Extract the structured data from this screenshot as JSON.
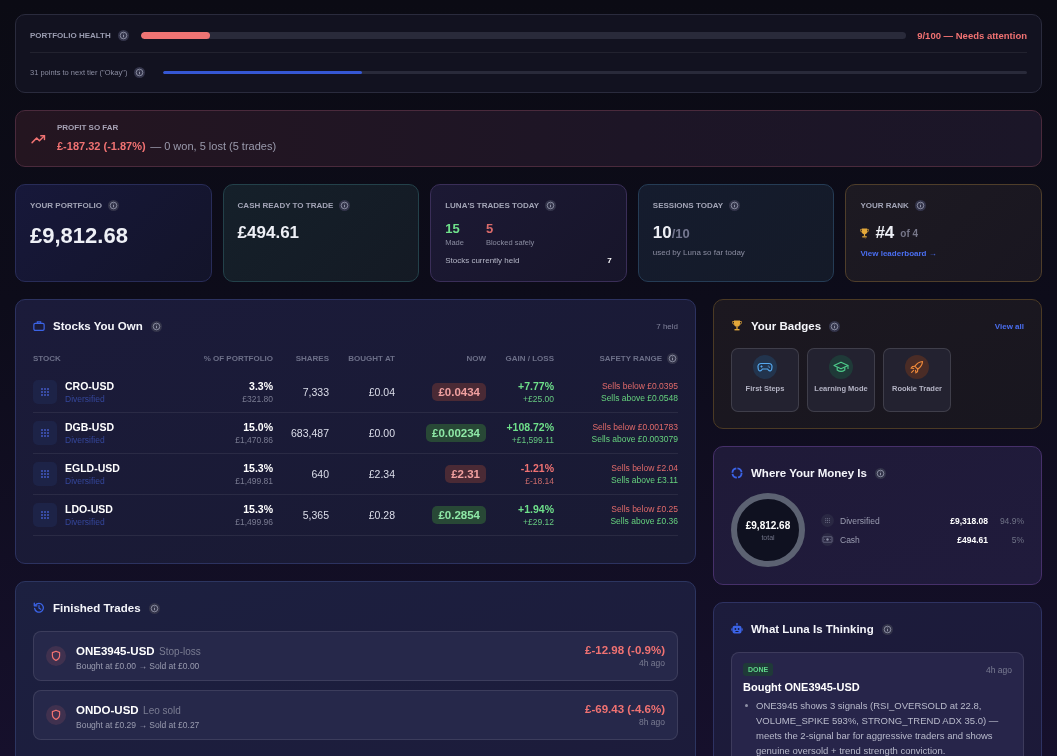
{
  "health": {
    "label": "PORTFOLIO HEALTH",
    "level": 0.09,
    "status": "9/100 — Needs attention",
    "next_tier": {
      "label": "31 points to next tier (\"Okay\")",
      "level": 0.23
    }
  },
  "profit": {
    "label": "PROFIT SO FAR",
    "amount": "£-187.32 (-1.87%)",
    "summary": "— 0 won, 5 lost (5 trades)",
    "loss": true
  },
  "stat_cards": [
    {
      "kind": "portfolio",
      "label": "YOUR PORTFOLIO",
      "value": "£9,812.68"
    },
    {
      "kind": "cash",
      "label": "CASH READY TO TRADE",
      "value": "£494.61"
    },
    {
      "kind": "trades",
      "label": "LUNA'S TRADES TODAY",
      "made": "15",
      "made_label": "Made",
      "blocked": "5",
      "blocked_label": "Blocked safely",
      "held_label": "Stocks currently held",
      "held": "7"
    },
    {
      "kind": "sessions",
      "label": "SESSIONS TODAY",
      "used": "10",
      "limit": "/10",
      "note": "used by Luna so far today"
    },
    {
      "kind": "rank",
      "label": "YOUR RANK",
      "rank": "#4",
      "out_of": "of 4",
      "link": "View leaderboard →"
    }
  ],
  "holdings": {
    "title": "Stocks You Own",
    "count": "7 held",
    "columns": [
      "STOCK",
      "% OF PORTFOLIO",
      "SHARES",
      "BOUGHT AT",
      "NOW",
      "GAIN / LOSS",
      "SAFETY RANGE"
    ],
    "rows": [
      {
        "ticker": "CRO-USD",
        "category": "Diversified",
        "share": "3.3%",
        "value": "£321.80",
        "shares": "7,333",
        "bought_at": "£0.04",
        "now": "£0.0434",
        "price_up": false,
        "gain_percent": "+7.77%",
        "gain_amount": "+£25.00",
        "gain_up": true,
        "sells_below": "Sells below £0.0395",
        "sells_above": "Sells above £0.0548"
      },
      {
        "ticker": "DGB-USD",
        "category": "Diversified",
        "share": "15.0%",
        "value": "£1,470.86",
        "shares": "683,487",
        "bought_at": "£0.00",
        "now": "£0.00234",
        "price_up": true,
        "gain_percent": "+108.72%",
        "gain_amount": "+£1,599.11",
        "gain_up": true,
        "sells_below": "Sells below £0.001783",
        "sells_above": "Sells above £0.003079"
      },
      {
        "ticker": "EGLD-USD",
        "category": "Diversified",
        "share": "15.3%",
        "value": "£1,499.81",
        "shares": "640",
        "bought_at": "£2.34",
        "now": "£2.31",
        "price_up": false,
        "gain_percent": "-1.21%",
        "gain_amount": "£-18.14",
        "gain_up": false,
        "sells_below": "Sells below £2.04",
        "sells_above": "Sells above £3.11"
      },
      {
        "ticker": "LDO-USD",
        "category": "Diversified",
        "share": "15.3%",
        "value": "£1,499.96",
        "shares": "5,365",
        "bought_at": "£0.28",
        "now": "£0.2854",
        "price_up": true,
        "gain_percent": "+1.94%",
        "gain_amount": "+£29.12",
        "gain_up": true,
        "sells_below": "Sells below £0.25",
        "sells_above": "Sells above £0.36"
      }
    ]
  },
  "finished_trades": {
    "title": "Finished Trades",
    "items": [
      {
        "ticker": "ONE3945-USD",
        "reason": "Stop-loss",
        "detail": "Bought at £0.00 → Sold at £0.00",
        "result": "£-12.98 (-0.9%)",
        "time": "4h ago",
        "loss": true
      },
      {
        "ticker": "ONDO-USD",
        "reason": "Leo sold",
        "detail": "Bought at £0.29 → Sold at £0.27",
        "result": "£-69.43 (-4.6%)",
        "time": "8h ago",
        "loss": true
      }
    ]
  },
  "badges": {
    "title": "Your Badges",
    "link": "View all",
    "items": [
      {
        "label": "First Steps"
      },
      {
        "label": "Learning Mode"
      },
      {
        "label": "Rookie Trader"
      }
    ]
  },
  "allocation": {
    "title": "Where Your Money Is",
    "total": "£9,812.68",
    "total_label": "total",
    "items": [
      {
        "label": "Diversified",
        "amount": "£9,318.08",
        "share": "94.9%"
      },
      {
        "label": "Cash",
        "amount": "£494.61",
        "share": "5%"
      }
    ]
  },
  "thinking": {
    "title": "What Luna Is Thinking",
    "entries": [
      {
        "status": "DONE",
        "time": "4h ago",
        "title": "Bought ONE3945-USD",
        "points": [
          "ONE3945 shows 3 signals (RSI_OVERSOLD at 22.8, VOLUME_SPIKE 593%, STRONG_TREND ADX 35.0) — meets the 2-signal bar for aggressive traders and shows genuine oversold + trend strength conviction."
        ]
      }
    ]
  }
}
